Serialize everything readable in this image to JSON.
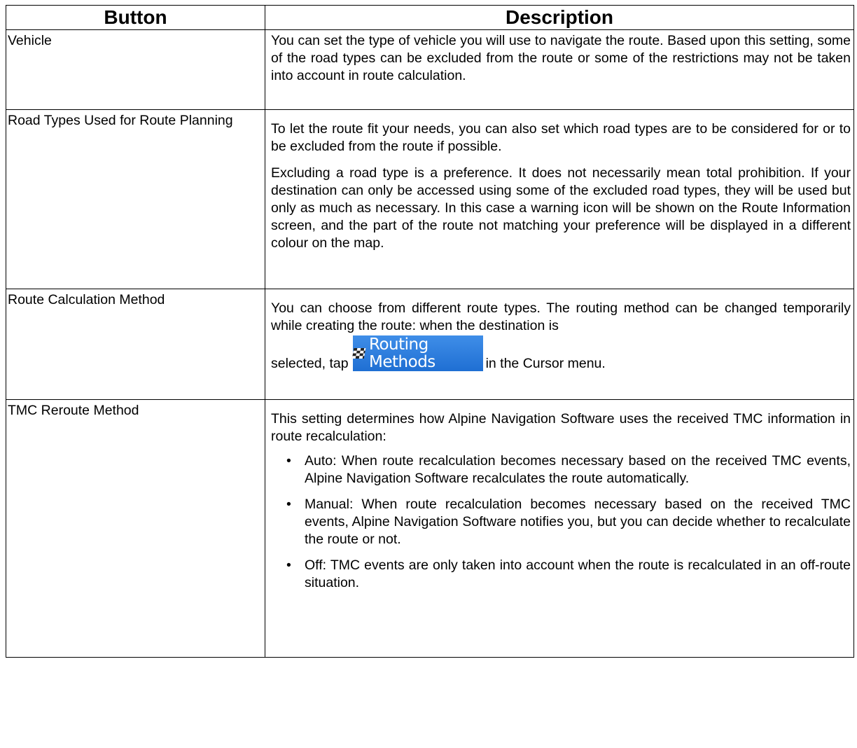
{
  "table": {
    "headers": {
      "button": "Button",
      "description": "Description"
    },
    "rows": [
      {
        "label": "Vehicle",
        "paragraphs": [
          "You can set the type of vehicle you will use to navigate the route. Based upon this setting, some of the road types can be excluded from the route or some of the restrictions may not be taken into account in route calculation."
        ]
      },
      {
        "label": "Road Types Used for Route Planning",
        "paragraphs": [
          "To let the route fit your needs, you can also set which road types are to be considered for or to be excluded from the route if possible.",
          "Excluding a road type is a preference. It does not necessarily mean total prohibition. If your destination can only be accessed using some of the excluded road types, they will be used but only as much as necessary. In this case a warning icon will be shown on the Route Information screen, and the part of the route not matching your preference will be displayed in a different colour on the map."
        ]
      },
      {
        "label": "Route Calculation Method",
        "paragraphs": [
          "You can choose from different route types. The routing method can be changed temporarily while creating the route: when the destination is"
        ],
        "inline_before": "selected, tap",
        "inline_button": {
          "label": "Routing Methods",
          "icon": "checkered-flag-icon",
          "color": "#2a7ade"
        },
        "inline_after": "in the Cursor menu."
      },
      {
        "label": "TMC Reroute Method",
        "paragraphs": [
          "This setting determines how Alpine Navigation Software uses the received TMC information in route recalculation:"
        ],
        "bullet_char": "•",
        "bullets": [
          "Auto: When route recalculation becomes necessary based on the received TMC events, Alpine Navigation Software recalculates the route automatically.",
          "Manual: When route recalculation becomes necessary based on the received TMC events, Alpine Navigation Software notifies you, but you can decide whether to recalculate the route or not.",
          "Off: TMC events are only taken into account when the route is recalculated in an off-route situation."
        ]
      }
    ]
  }
}
